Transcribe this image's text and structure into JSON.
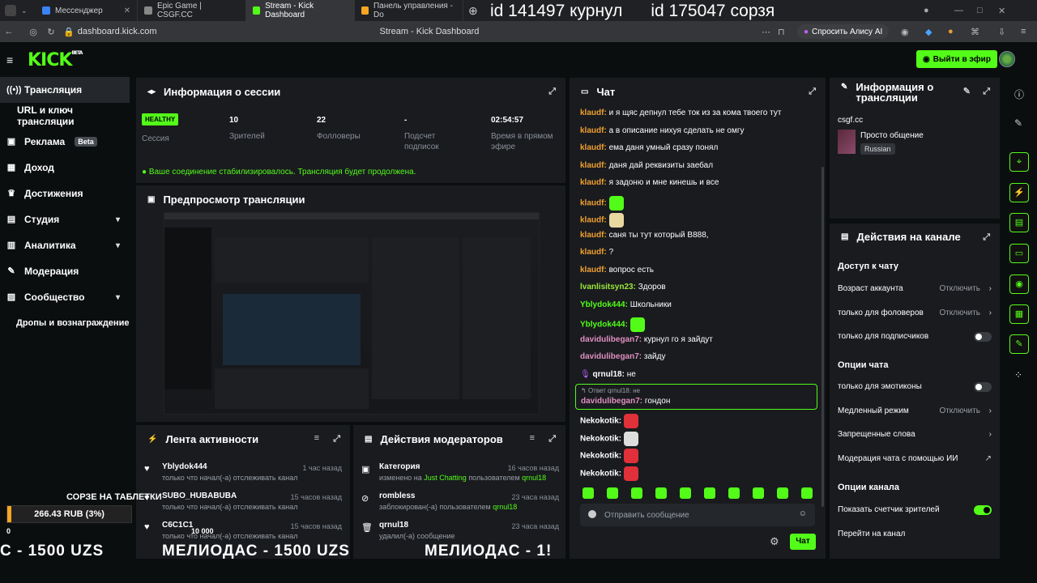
{
  "browser": {
    "tabs": [
      {
        "label": "Мессенджер",
        "color": "#3b82f6"
      },
      {
        "label": "Epic Game | CSGF.CC",
        "color": "#888888"
      },
      {
        "label": "Stream - Kick Dashboard",
        "color": "#53fc18"
      },
      {
        "label": "Панель управления - Do",
        "color": "#f5a623"
      }
    ],
    "url": "dashboard.kick.com",
    "page_title": "Stream - Kick Dashboard",
    "alisa": "Спросить Алису AI",
    "overlay_text": "id 141497 курнул      id 175047 сорзя"
  },
  "header": {
    "logo": "KICK",
    "logo_sup": "BETA",
    "go_live": "Выйти в эфир"
  },
  "sidebar": {
    "items": [
      {
        "label": "Трансляция",
        "icon": "broadcast-icon"
      },
      {
        "label": "URL и ключ трансляции",
        "icon": ""
      },
      {
        "label": "Реклама",
        "icon": "ad-icon",
        "badge": "Beta"
      },
      {
        "label": "Доход",
        "icon": "income-icon"
      },
      {
        "label": "Достижения",
        "icon": "trophy-icon"
      },
      {
        "label": "Студия",
        "icon": "studio-icon"
      },
      {
        "label": "Аналитика",
        "icon": "analytics-icon"
      },
      {
        "label": "Модерация",
        "icon": "wrench-icon"
      },
      {
        "label": "Сообщество",
        "icon": "community-icon"
      },
      {
        "label": "Дропы и вознаграждение",
        "icon": ""
      }
    ]
  },
  "session": {
    "title": "Информация о сессии",
    "status": "HEALTHY",
    "status_label": "Сессия",
    "viewers": "10",
    "viewers_label": "Зрителей",
    "followers": "22",
    "followers_label": "Фолловеры",
    "subs": "-",
    "subs_label": "Подсчет подписок",
    "uptime": "02:54:57",
    "uptime_label": "Время в прямом эфире",
    "message": "Ваше соединение стабилизировалось. Трансляция будет продолжена."
  },
  "preview": {
    "title": "Предпросмотр трансляции"
  },
  "activity": {
    "title": "Лента активности",
    "items": [
      {
        "name": "Yblydok444",
        "desc": "только что начал(-а) отслеживать канал",
        "time": "1 час назад"
      },
      {
        "name": "SUBO_HUBABUBA",
        "desc": "только что начал(-а) отслеживать канал",
        "time": "15 часов назад"
      },
      {
        "name": "C6C1C1",
        "desc": "только что начал(-а) отслеживать канал",
        "time": "15 часов назад"
      }
    ]
  },
  "modactions": {
    "title": "Действия модераторов",
    "items": [
      {
        "name": "Категория",
        "desc_pre": "изменено на ",
        "hl": "Just Chatting",
        "desc_mid": " пользователем ",
        "user": "qrnul18",
        "time": "16 часов назад"
      },
      {
        "name": "rombless",
        "desc_pre": "заблокирован(-а) пользователем ",
        "hl": "",
        "desc_mid": "",
        "user": "qrnul18",
        "time": "23 часа назад"
      },
      {
        "name": "qrnul18",
        "desc_pre": "удалил(-а) сообщение",
        "hl": "",
        "desc_mid": "",
        "user": "",
        "time": "23 часа назад"
      }
    ]
  },
  "chat": {
    "title": "Чат",
    "messages": [
      {
        "user": "klaudf",
        "cls": "u-o",
        "text": "и я щяс депнул тебе ток из за кома твоего тут"
      },
      {
        "user": "klaudf",
        "cls": "u-o",
        "text": "а в описание нихуя сделать не омгу"
      },
      {
        "user": "klaudf",
        "cls": "u-o",
        "text": "ема даня умный сразу понял"
      },
      {
        "user": "klaudf",
        "cls": "u-o",
        "text": "даня дай реквизиты заебал"
      },
      {
        "user": "klaudf",
        "cls": "u-o",
        "text": "я задоню и мне кинешь и все"
      },
      {
        "user": "klaudf",
        "cls": "u-o",
        "text": "",
        "emote": "#53fc18"
      },
      {
        "user": "klaudf",
        "cls": "u-o",
        "text": "",
        "emote": "#e8d8a0"
      },
      {
        "user": "klaudf",
        "cls": "u-o",
        "text": "саня ты тут который В888,"
      },
      {
        "user": "klaudf",
        "cls": "u-o",
        "text": "?"
      },
      {
        "user": "klaudf",
        "cls": "u-o",
        "text": "вопрос есть"
      },
      {
        "user": "lvanlisitsyn23",
        "cls": "u-y",
        "text": "Здоров"
      },
      {
        "user": "Yblydok444",
        "cls": "u-g",
        "text": "Школьники"
      },
      {
        "user": "Yblydok444",
        "cls": "u-g",
        "text": "",
        "emote": "#53fc18"
      },
      {
        "user": "davidulibegan7",
        "cls": "u-p",
        "text": "курнул го я зайдут"
      },
      {
        "user": "davidulibegan7",
        "cls": "u-p",
        "text": "зайду"
      },
      {
        "user": "qrnul18",
        "cls": "u-w",
        "text": "не"
      }
    ],
    "reply_label": "Ответ qrnul18: не",
    "reply_user": "davidulibegan7",
    "reply_text": "гондон",
    "after": [
      {
        "user": "Nekokotik",
        "cls": "u-w",
        "emote": "#e0303a"
      },
      {
        "user": "Nekokotik",
        "cls": "u-w",
        "emote": "#dddddd"
      },
      {
        "user": "Nekokotik",
        "cls": "u-w",
        "emote": "#e0303a"
      },
      {
        "user": "Nekokotik",
        "cls": "u-w",
        "emote": "#e0303a"
      }
    ],
    "placeholder": "Отправить сообщение",
    "send": "Чат"
  },
  "streaminfo": {
    "title": "Информация о трансляции",
    "channel": "csgf.cc",
    "stream_title": "Просто общение",
    "language": "Russian"
  },
  "channelactions": {
    "title": "Действия на канале",
    "access_title": "Доступ к чату",
    "rows_access": [
      {
        "label": "Возраст аккаунта",
        "val": "Отключить",
        "type": "arrow"
      },
      {
        "label": "только для фоловеров",
        "val": "Отключить",
        "type": "arrow"
      },
      {
        "label": "только для подписчиков",
        "val": "",
        "type": "toggle-off"
      }
    ],
    "chatopt_title": "Опции чата",
    "rows_chat": [
      {
        "label": "только для эмотиконы",
        "val": "",
        "type": "toggle-off"
      },
      {
        "label": "Медленный режим",
        "val": "Отключить",
        "type": "arrow"
      },
      {
        "label": "Запрещенные слова",
        "val": "",
        "type": "arrow"
      },
      {
        "label": "Модерация чата с помощью ИИ",
        "val": "",
        "type": "ext"
      }
    ],
    "chanopt_title": "Опции канала",
    "rows_chan": [
      {
        "label": "Показать счетчик зрителей",
        "val": "",
        "type": "toggle-on"
      },
      {
        "label": "Перейти на канал",
        "val": "",
        "type": ""
      }
    ]
  },
  "overlay": {
    "donation_title": "СОРЗЕ НА ТАБЛЕТКИ",
    "donation_amount": "266.43 RUB (3%)",
    "donation_progress": 0.03,
    "donation_min": "0",
    "donation_max": "10 000",
    "ticker_left": "С - 1500 UZS",
    "ticker_mid": "МЕЛИОДАС - 1500 UZS",
    "ticker_right": "МЕЛИОДАС - 1!"
  }
}
